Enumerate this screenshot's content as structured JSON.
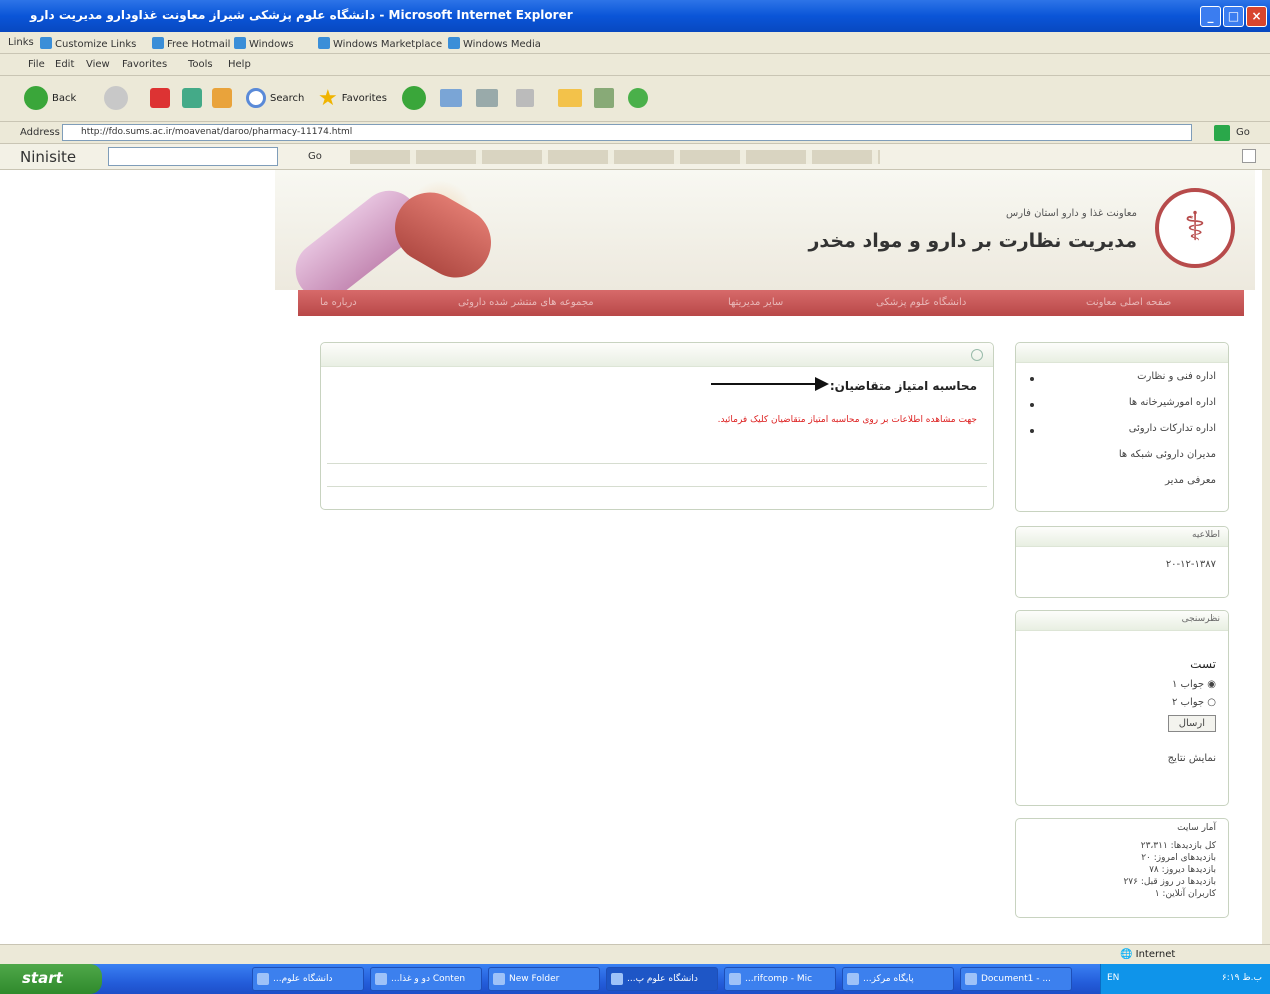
{
  "window": {
    "title": "دانشگاه علوم پزشکی شیراز معاونت غذاودارو مدیریت دارو - Microsoft Internet Explorer"
  },
  "linksbar": {
    "items": [
      "Links",
      "Customize Links",
      "Free Hotmail",
      "Windows",
      "Windows Marketplace",
      "Windows Media"
    ]
  },
  "menubar": {
    "items": [
      "File",
      "Edit",
      "View",
      "Favorites",
      "Tools",
      "Help"
    ]
  },
  "toolbar": {
    "back": "Back",
    "search": "Search",
    "favorites": "Favorites"
  },
  "address": {
    "label": "Address",
    "url": "http://fdo.sums.ac.ir/moavenat/daroo/pharmacy-11174.html",
    "go": "Go"
  },
  "ninisite": {
    "brand": "Ninisite",
    "go": "Go"
  },
  "header": {
    "subtitle": "معاونت غذا و دارو استان فارس",
    "title": "مدیریت نظارت بر دارو و مواد مخدر"
  },
  "nav": [
    "درباره ما",
    "مجموعه های منتشر شده داروئی",
    "سایر مدیریتها",
    "دانشگاه علوم پزشکی",
    "صفحه اصلی معاونت"
  ],
  "main": {
    "title": "محاسبه امتیاز متقاضیان:",
    "note": "جهت مشاهده اطلاعات بر روی محاسبه امتیاز متقاضیان کلیک فرمائید."
  },
  "sidebar": {
    "links": [
      "اداره فنی و نظارت",
      "اداره امورشیرخانه ها",
      "اداره تدارکات داروئی",
      "مدیران داروئی شبکه ها",
      "معرفی مدیر"
    ],
    "news_title": "اطلاعیه",
    "news_value": "۲۰-۱۲-۱۳۸۷",
    "poll_title": "نظرسنجی",
    "poll_q": "تست",
    "poll_opt1": "جواب ۱",
    "poll_opt2": "جواب ۲",
    "poll_submit": "ارسال",
    "poll_results": "نمایش نتایج",
    "stats_title": "آمار سایت",
    "stats": [
      "کل بازدیدها: ۲۳،۳۱۱",
      "بازدیدهای امروز: ۲۰",
      "بازدیدها دیروز: ۷۸",
      "بازدیدها در روز قبل: ۲۷۶",
      "کاربران آنلاین: ۱"
    ]
  },
  "status": {
    "zone": "Internet"
  },
  "taskbar": {
    "start": "start",
    "tasks": [
      "...دانشگاه علوم",
      "...دو و غذا Conten",
      "New Folder",
      "...دانشگاه علوم پ",
      "...rifcomp - Mic",
      "...پایگاه مرکز",
      "Document1 - ..."
    ],
    "lang": "EN",
    "time": "۶:۱۹ ب.ظ"
  }
}
